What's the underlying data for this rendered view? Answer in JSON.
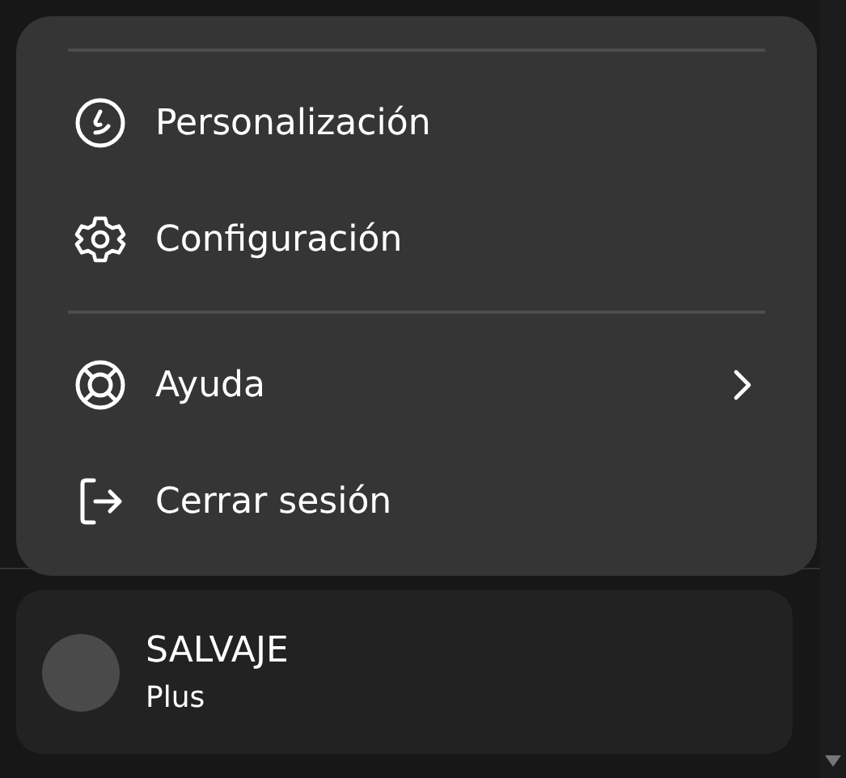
{
  "menu": {
    "sections": [
      {
        "items": [
          {
            "label": "Personalización",
            "submenu": false
          },
          {
            "label": "Configuración",
            "submenu": false
          }
        ]
      },
      {
        "items": [
          {
            "label": "Ayuda",
            "submenu": true
          },
          {
            "label": "Cerrar sesión",
            "submenu": false
          }
        ]
      }
    ]
  },
  "user": {
    "name": "SALVAJE",
    "plan": "Plus"
  }
}
